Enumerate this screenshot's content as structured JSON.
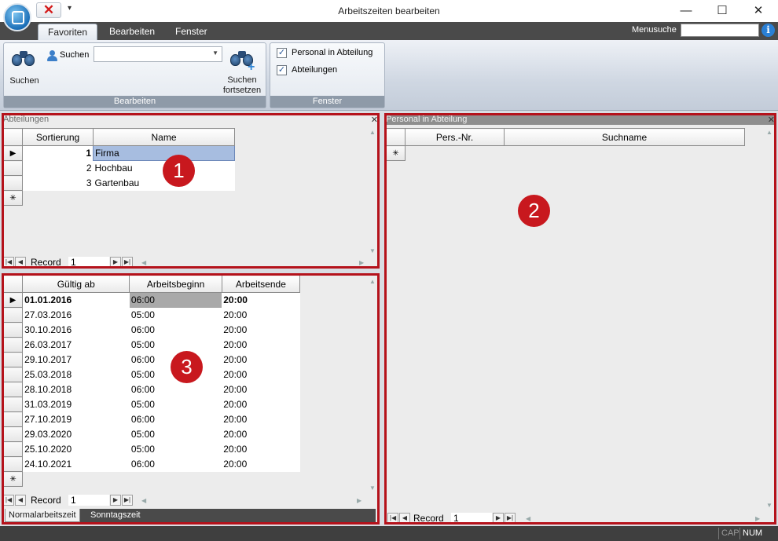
{
  "window": {
    "title": "Arbeitszeiten bearbeiten",
    "qat_close_glyph": "✕",
    "qat_more_glyph": "▾",
    "minimize_glyph": "—",
    "maximize_glyph": "☐",
    "close_glyph": "✕"
  },
  "ribbon": {
    "tabs": [
      "Favoriten",
      "Bearbeiten",
      "Fenster"
    ],
    "active_tab": "Favoriten",
    "menusuche_label": "Menusuche",
    "menusuche_value": "",
    "info_glyph": "i",
    "groups": {
      "bearbeiten": {
        "caption": "Bearbeiten",
        "suchen_big_label": "Suchen",
        "suchen_small_label": "Suchen",
        "suchen_combo_value": "",
        "suchen_fortsetzen_label_1": "Suchen",
        "suchen_fortsetzen_label_2": "fortsetzen"
      },
      "fenster": {
        "caption": "Fenster",
        "checks": [
          {
            "label": "Personal in Abteilung",
            "checked": true
          },
          {
            "label": "Abteilungen",
            "checked": true
          }
        ]
      }
    }
  },
  "abteilungen": {
    "caption": "Abteilungen",
    "columns": [
      "Sortierung",
      "Name"
    ],
    "rows": [
      {
        "sortierung": "1",
        "name": "Firma"
      },
      {
        "sortierung": "2",
        "name": "Hochbau"
      },
      {
        "sortierung": "3",
        "name": "Gartenbau"
      }
    ],
    "record_label": "Record",
    "record_value": "1"
  },
  "personal": {
    "caption": "Personal in Abteilung",
    "columns": [
      "Pers.-Nr.",
      "Suchname"
    ],
    "record_label": "Record",
    "record_value": "1"
  },
  "arbeitszeiten": {
    "columns": [
      "Gültig ab",
      "Arbeitsbeginn",
      "Arbeitsende"
    ],
    "rows": [
      {
        "gueltig": "01.01.2016",
        "beginn": "06:00",
        "ende": "20:00"
      },
      {
        "gueltig": "27.03.2016",
        "beginn": "05:00",
        "ende": "20:00"
      },
      {
        "gueltig": "30.10.2016",
        "beginn": "06:00",
        "ende": "20:00"
      },
      {
        "gueltig": "26.03.2017",
        "beginn": "05:00",
        "ende": "20:00"
      },
      {
        "gueltig": "29.10.2017",
        "beginn": "06:00",
        "ende": "20:00"
      },
      {
        "gueltig": "25.03.2018",
        "beginn": "05:00",
        "ende": "20:00"
      },
      {
        "gueltig": "28.10.2018",
        "beginn": "06:00",
        "ende": "20:00"
      },
      {
        "gueltig": "31.03.2019",
        "beginn": "05:00",
        "ende": "20:00"
      },
      {
        "gueltig": "27.10.2019",
        "beginn": "06:00",
        "ende": "20:00"
      },
      {
        "gueltig": "29.03.2020",
        "beginn": "05:00",
        "ende": "20:00"
      },
      {
        "gueltig": "25.10.2020",
        "beginn": "05:00",
        "ende": "20:00"
      },
      {
        "gueltig": "24.10.2021",
        "beginn": "06:00",
        "ende": "20:00"
      }
    ],
    "record_label": "Record",
    "record_value": "1",
    "subtabs": [
      "Normalarbeitszeit",
      "Sonntagszeit"
    ]
  },
  "badges": [
    "1",
    "2",
    "3"
  ],
  "grid_glyphs": {
    "current": "▶",
    "new": "✳",
    "close": "✕"
  },
  "status": {
    "cap": "CAP",
    "num": "NUM"
  },
  "colors": {
    "frame_red": "#b5121b",
    "badge_red": "#c8181e",
    "selection_blue": "#a7bde0"
  }
}
